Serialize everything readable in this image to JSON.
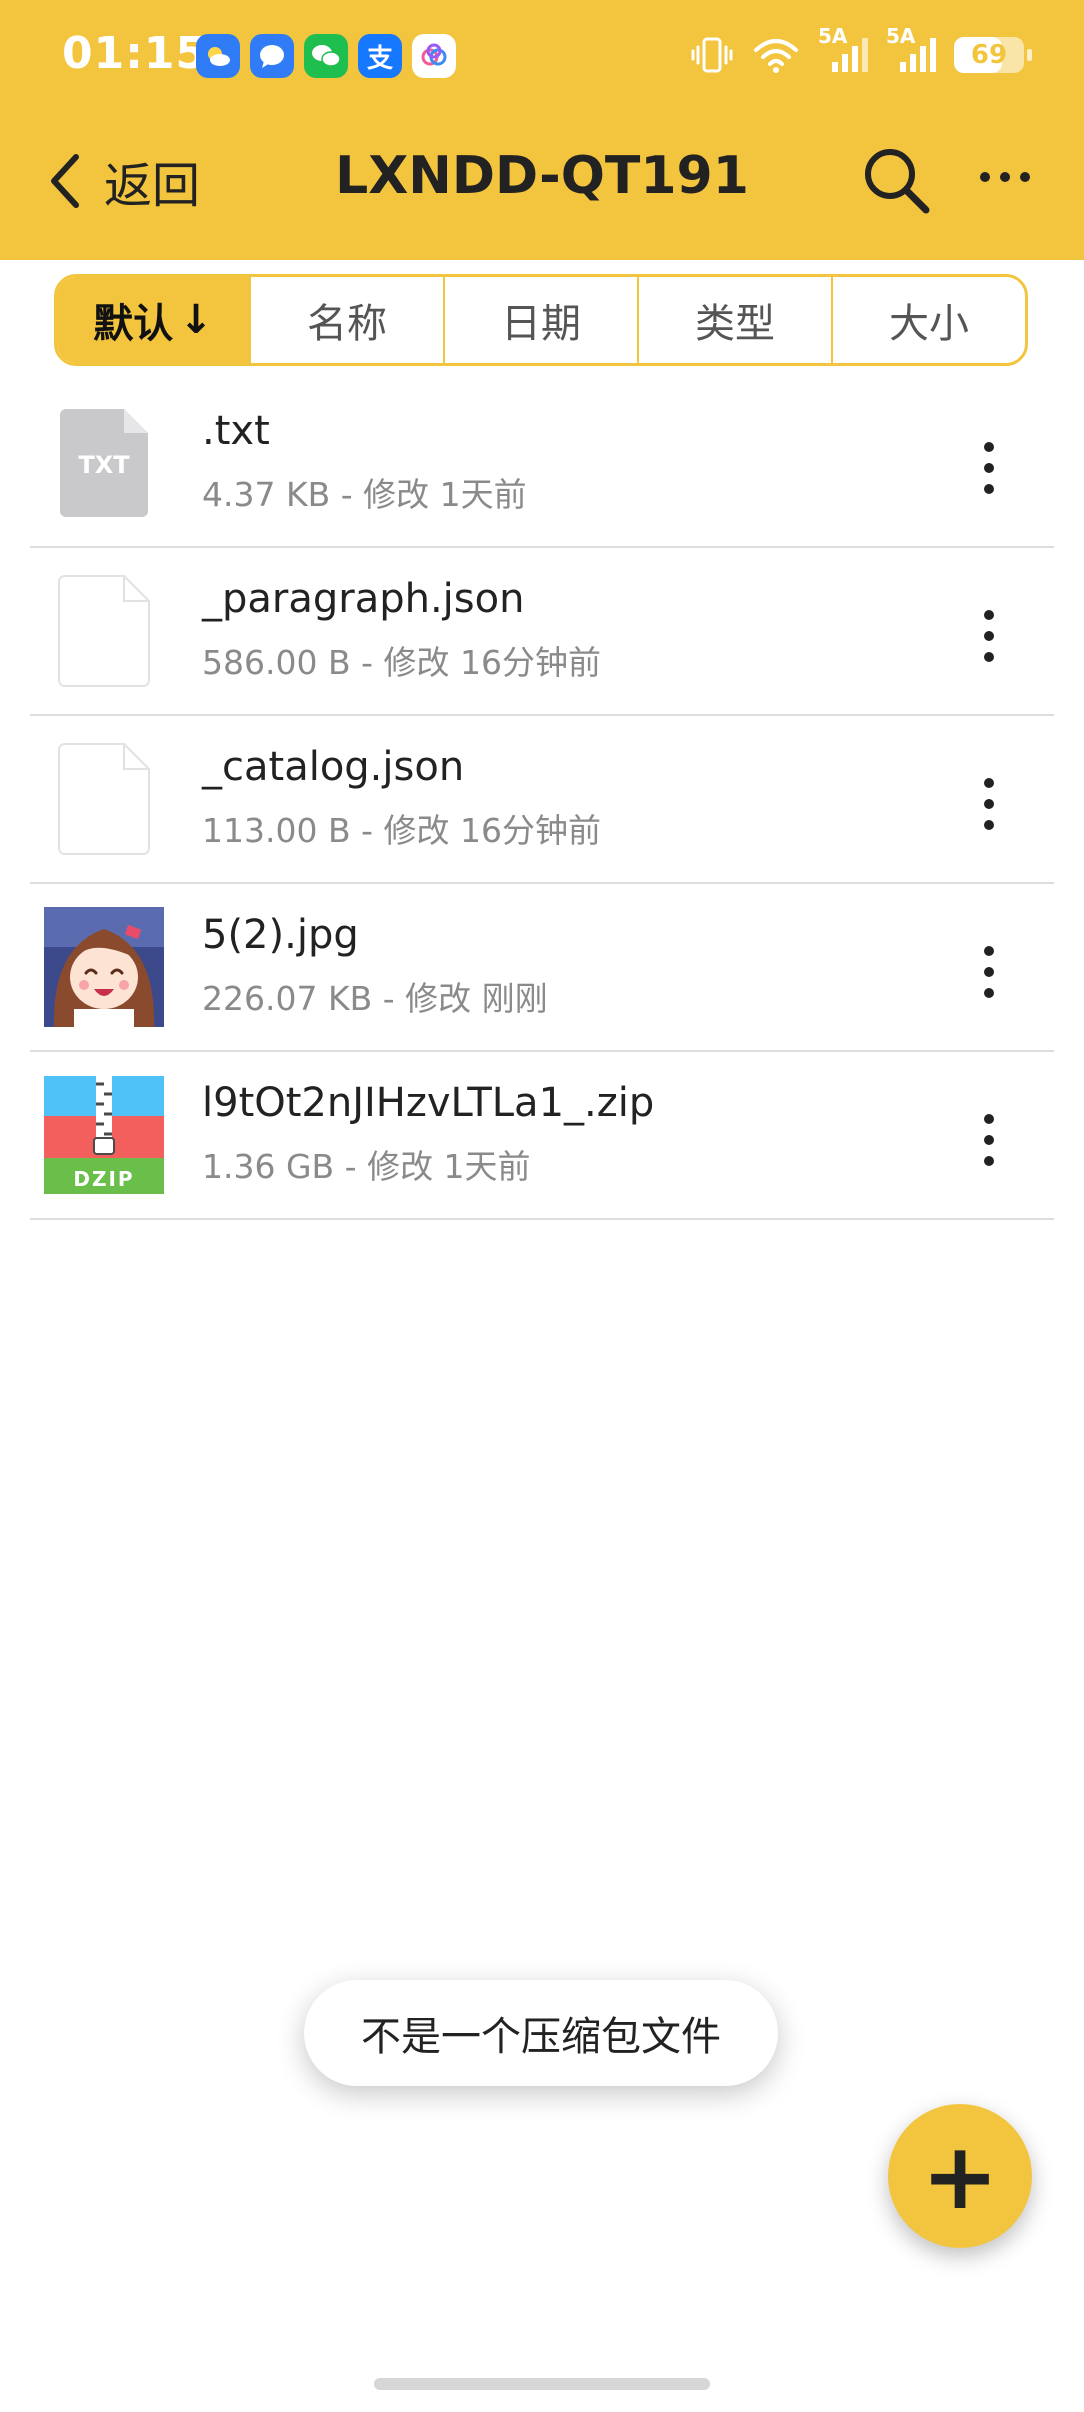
{
  "status": {
    "time": "01:15",
    "net1": "5A",
    "net2": "5A",
    "battery": "69",
    "battery_level": 0.69,
    "app_icons": [
      "weather-icon",
      "messages-icon",
      "wechat-icon",
      "alipay-icon",
      "cloud-icon"
    ]
  },
  "appbar": {
    "back_label": "返回",
    "title": "LXNDD-QT191"
  },
  "sort": {
    "tabs": [
      "默认",
      "名称",
      "日期",
      "类型",
      "大小"
    ],
    "active_arrow": "↓"
  },
  "files": [
    {
      "name": ".txt",
      "meta": "4.37 KB - 修改 1天前",
      "type": "txt",
      "badge": "TXT"
    },
    {
      "name": "_paragraph.json",
      "meta": "586.00 B - 修改 16分钟前",
      "type": "blank"
    },
    {
      "name": "_catalog.json",
      "meta": "113.00 B - 修改 16分钟前",
      "type": "blank"
    },
    {
      "name": "5(2).jpg",
      "meta": "226.07 KB - 修改 刚刚",
      "type": "image"
    },
    {
      "name": "l9tOt2nJIHzvLTLa1_.zip",
      "meta": "1.36 GB - 修改 1天前",
      "type": "zip",
      "badge": "DZIP"
    }
  ],
  "toast": "不是一个压缩包文件",
  "fab_label": "+",
  "colors": {
    "accent": "#f3c53f",
    "zip_top": "#4fc3f7",
    "zip_mid": "#f25f5c",
    "zip_bottom": "#6abf4b"
  }
}
